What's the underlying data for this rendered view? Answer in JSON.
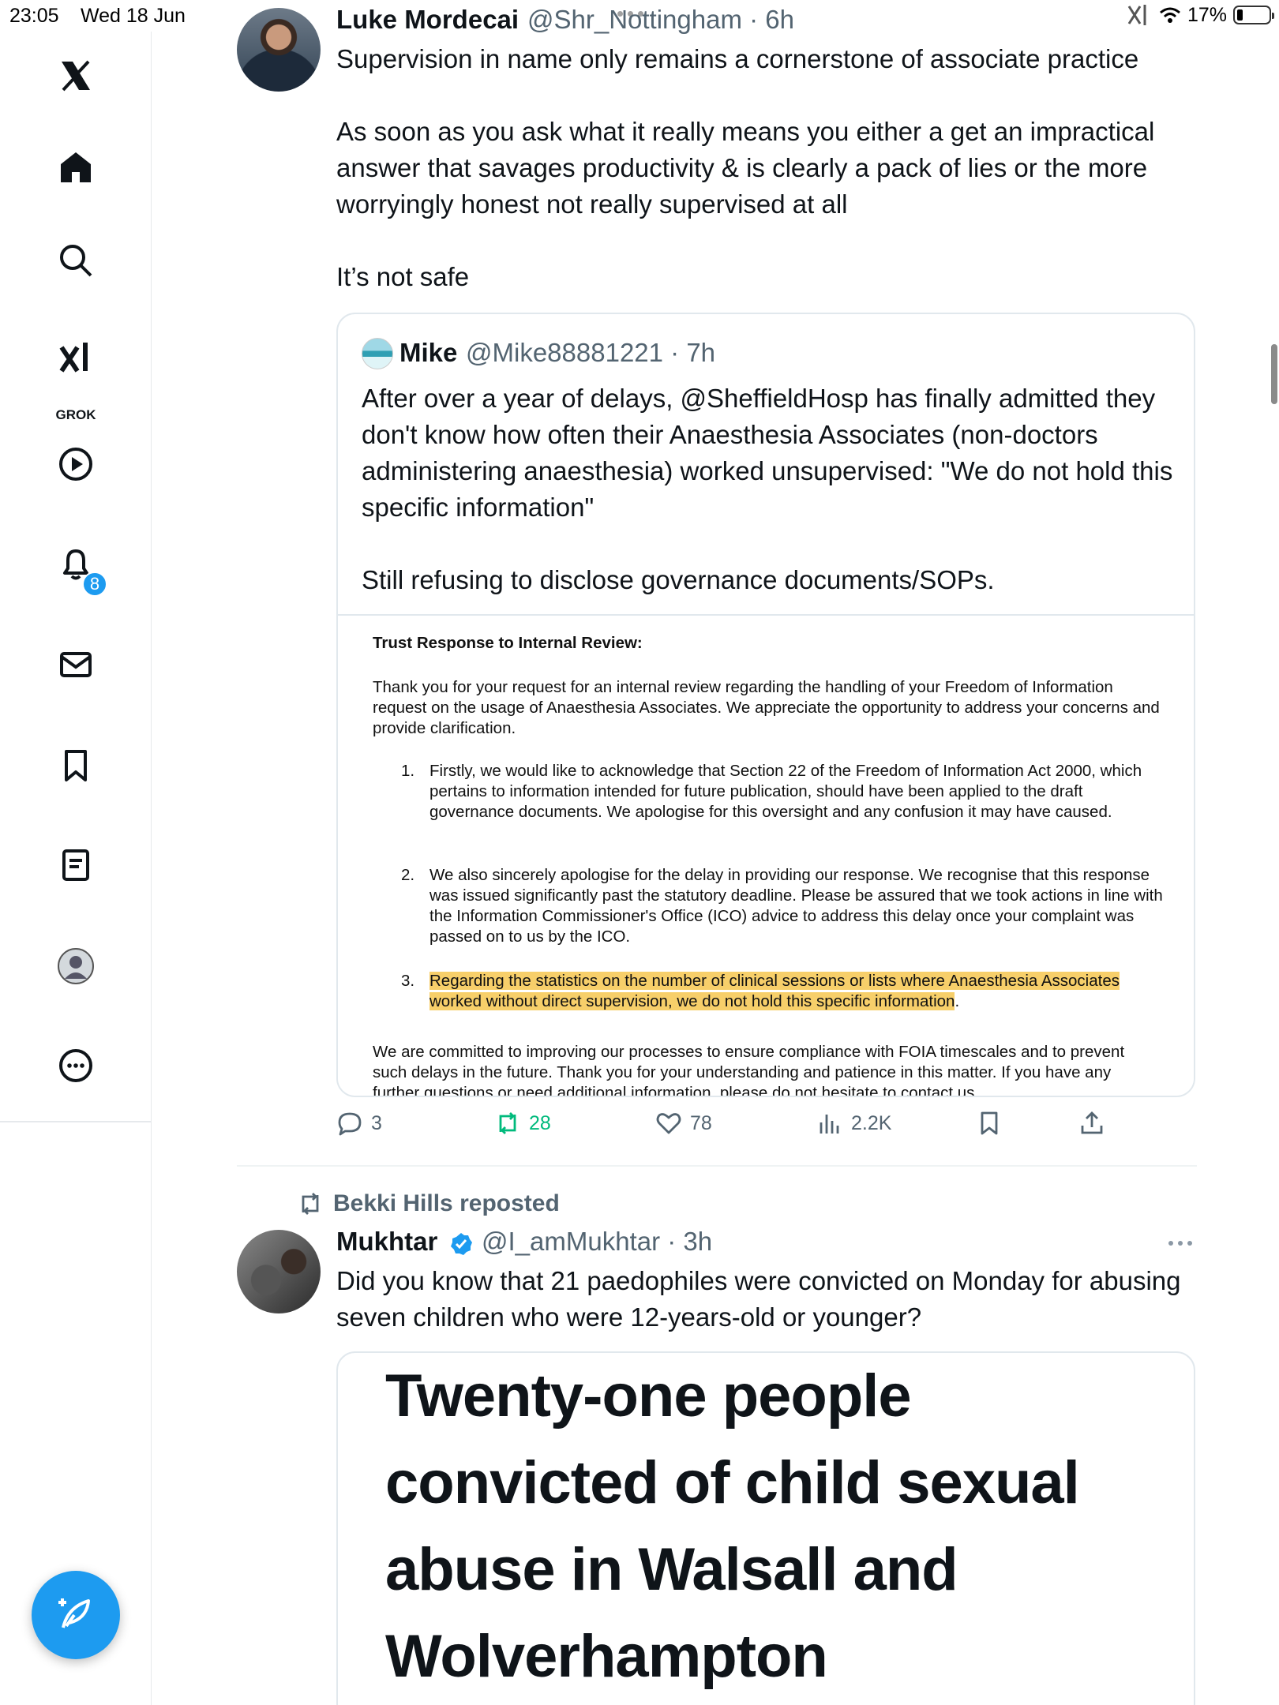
{
  "status_bar": {
    "time": "23:05",
    "date": "Wed 18 Jun",
    "battery": "17%"
  },
  "sidebar": {
    "grok_label": "GROK",
    "notifications_badge": "8",
    "items": [
      "home-icon",
      "search-icon",
      "grok-icon",
      "video-icon",
      "bell-icon",
      "mail-icon",
      "bookmark-icon",
      "list-icon",
      "avatar",
      "more-icon"
    ]
  },
  "tweet1": {
    "author_name": "Luke Mordecai",
    "author_handle": "@Shr_Nottingham · 6h",
    "text": "Supervision in name only remains a cornerstone of associate practice\n\nAs soon as you ask what it really means you either a get an impractical answer that savages productivity & is clearly a pack of lies or the more worryingly honest not really supervised at all\n\nIt’s not safe",
    "quote": {
      "author_name": "Mike",
      "author_handle": "@Mike88881221 · 7h",
      "text": "After over a year of delays, @SheffieldHosp has finally admitted they don't know how often their Anaesthesia Associates (non-doctors administering anaesthesia) worked unsupervised: \"We do not hold this specific information\"\n\nStill refusing to disclose governance documents/SOPs.",
      "document": {
        "title": "Trust Response to Internal Review:",
        "intro": "Thank you for your request for an internal review regarding the handling of your Freedom of Information request on the usage of Anaesthesia Associates. We appreciate the opportunity to address your concerns and provide clarification.",
        "items": [
          {
            "num": "1.",
            "text": "Firstly, we would like to acknowledge that Section 22 of the Freedom of Information Act 2000, which pertains to information intended for future publication, should have been applied to the draft governance documents. We apologise for this oversight and any confusion it may have caused."
          },
          {
            "num": "2.",
            "text": "We also sincerely apologise for the delay in providing our response. We recognise that this response was issued significantly past the statutory deadline. Please be assured that we took actions in line with the Information Commissioner's Office (ICO) advice to address this delay once your complaint was passed on to us by the ICO."
          },
          {
            "num": "3.",
            "text": "Regarding the statistics on the number of clinical sessions or lists where Anaesthesia Associates worked without direct supervision, we do not hold this specific information",
            "suffix": "."
          }
        ],
        "closing": "We are committed to improving our processes to ensure compliance with FOIA timescales and to prevent such delays in the future. Thank you for your understanding and patience in this matter. If you have any further questions or need additional information, please do not hesitate to contact us."
      }
    },
    "stats": {
      "replies": "3",
      "reposts": "28",
      "likes": "78",
      "views": "2.2K"
    }
  },
  "tweet2": {
    "repost_label": "Bekki Hills reposted",
    "author_name": "Mukhtar",
    "author_handle": "@I_amMukhtar · 3h",
    "text": "Did you know that 21 paedophiles were convicted on Monday for abusing seven children who were 12-years-old or younger?",
    "card_headline": "Twenty-one people\nconvicted of child sexual\nabuse in Walsall and\nWolverhampton"
  },
  "colors": {
    "accent": "#1d9bf0",
    "repost_green": "#00ba7c",
    "highlight": "#f7cf6a",
    "muted": "#536471"
  }
}
